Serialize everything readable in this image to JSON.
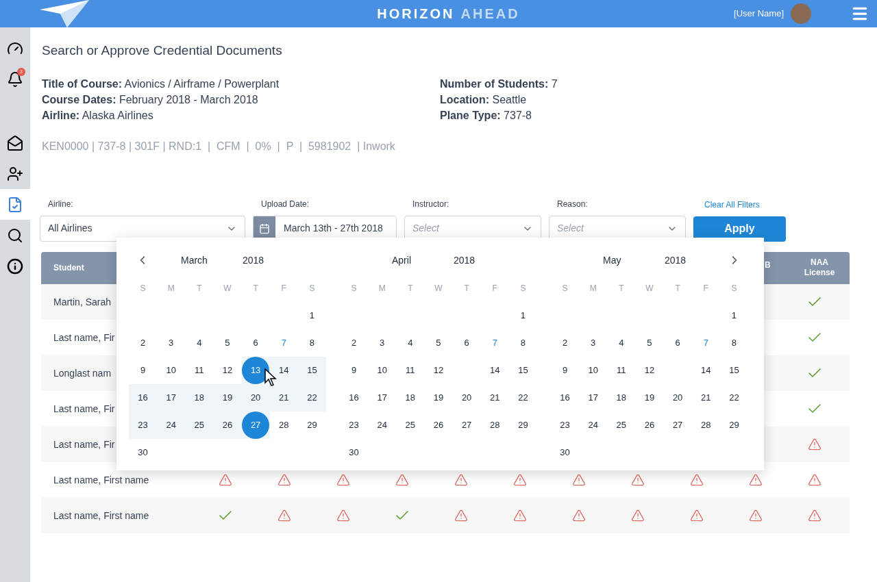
{
  "topbar": {
    "brand_primary": "HORIZON",
    "brand_secondary": "AHEAD",
    "user_name": "[User Name]"
  },
  "sidebar": {
    "items": [
      {
        "kind": "gauge",
        "selected": false
      },
      {
        "kind": "bell",
        "selected": false,
        "badge": "3"
      },
      {
        "kind": "mail",
        "selected": false
      },
      {
        "kind": "user-add",
        "selected": false
      },
      {
        "kind": "document",
        "selected": true
      },
      {
        "kind": "search",
        "selected": false
      },
      {
        "kind": "info",
        "selected": false
      }
    ]
  },
  "page_title": "Search or Approve Credential Documents",
  "course_info": {
    "left": [
      {
        "label": "Title of Course:",
        "value": "Avionics / Airframe / Powerplant"
      },
      {
        "label": "Course Dates:",
        "value": "February 2018 - March 2018"
      },
      {
        "label": "Airline:",
        "value": "Alaska Airlines"
      }
    ],
    "right": [
      {
        "label": "Number of Students:",
        "value": "7"
      },
      {
        "label": "Location:",
        "value": "Seattle"
      },
      {
        "label": "Plane Type:",
        "value": "737-8"
      }
    ],
    "code_line": "KEN0000 | 737-8 | 301F | RND:1  |  CFM  |  0%  |  P  |  5981902  | Inwork"
  },
  "filters": {
    "airline": {
      "label": "Airline:",
      "value": "All Airlines"
    },
    "upload_date": {
      "label": "Upload Date:",
      "value": "March 13th -  27th 2018"
    },
    "instructor": {
      "label": "Instructor:",
      "placeholder": "Select"
    },
    "reason": {
      "label": "Reason:",
      "placeholder": "Select"
    },
    "clear_link": "Clear All Filters",
    "apply_button": "Apply"
  },
  "table": {
    "columns": [
      "Student",
      "B",
      "NAA License"
    ],
    "rows": [
      {
        "student": "Martin, Sarah",
        "naa_license": {
          "kind": "check"
        }
      },
      {
        "student": "Last name, Fir",
        "naa_license": {
          "kind": "check"
        }
      },
      {
        "student": "Longlast nam",
        "naa_license": {
          "kind": "check"
        }
      },
      {
        "student": "Last name, Fir",
        "naa_license": {
          "kind": "check"
        }
      },
      {
        "student": "Last name, Fir",
        "naa_license": {
          "kind": "warning"
        }
      },
      {
        "student": "Last name, First name",
        "cells": [
          {
            "kind": "warning"
          },
          {
            "kind": "warning"
          },
          {
            "kind": "warning"
          },
          {
            "kind": "warning"
          },
          {
            "kind": "warning"
          },
          {
            "kind": "warning"
          },
          {
            "kind": "warning"
          },
          {
            "kind": "warning"
          },
          {
            "kind": "warning"
          },
          {
            "kind": "warning"
          }
        ],
        "naa_license": {
          "kind": "warning"
        }
      },
      {
        "student": "Last name, First name",
        "cells": [
          {
            "kind": "check"
          },
          {
            "kind": "warning"
          },
          {
            "kind": "warning"
          },
          {
            "kind": "check"
          },
          {
            "kind": "warning"
          },
          {
            "kind": "warning"
          },
          {
            "kind": "warning"
          },
          {
            "kind": "warning"
          },
          {
            "kind": "warning"
          },
          {
            "kind": "warning"
          }
        ],
        "naa_license": {
          "kind": "warning"
        }
      }
    ]
  },
  "calendar": {
    "months": [
      {
        "month": "March",
        "year": "2018",
        "weekdays": [
          "S",
          "M",
          "T",
          "W",
          "T",
          "F",
          "S"
        ],
        "weeks": [
          {
            "days": [
              {
                "kind": "day",
                "label": "1",
                "selected": false,
                "in_range": false,
                "accent": false
              }
            ]
          },
          {
            "days": [
              {
                "kind": "day",
                "label": "2",
                "selected": false,
                "in_range": false,
                "accent": false
              },
              {
                "kind": "day",
                "label": "3",
                "selected": false,
                "in_range": false,
                "accent": false
              },
              {
                "kind": "day",
                "label": "4",
                "selected": false,
                "in_range": false,
                "accent": false
              },
              {
                "kind": "day",
                "label": "5",
                "selected": false,
                "in_range": false,
                "accent": false
              },
              {
                "kind": "day",
                "label": "6",
                "selected": false,
                "in_range": false,
                "accent": false
              },
              {
                "kind": "day",
                "label": "7",
                "selected": false,
                "in_range": false,
                "accent": true
              },
              {
                "kind": "day",
                "label": "8",
                "selected": false,
                "in_range": false,
                "accent": false
              }
            ]
          },
          {
            "days": [
              {
                "kind": "day",
                "label": "9",
                "selected": false,
                "in_range": false,
                "accent": false
              },
              {
                "kind": "day",
                "label": "10",
                "selected": false,
                "in_range": false,
                "accent": false
              },
              {
                "kind": "day",
                "label": "11",
                "selected": false,
                "in_range": false,
                "accent": false
              },
              {
                "kind": "day",
                "label": "12",
                "selected": false,
                "in_range": false,
                "accent": false
              },
              {
                "kind": "day",
                "label": "13",
                "selected": true,
                "in_range": true,
                "accent": false
              },
              {
                "kind": "day",
                "label": "14",
                "selected": false,
                "in_range": true,
                "accent": false
              },
              {
                "kind": "day",
                "label": "15",
                "selected": false,
                "in_range": true,
                "accent": false
              }
            ]
          },
          {
            "days": [
              {
                "kind": "day",
                "label": "16",
                "selected": false,
                "in_range": true,
                "accent": false
              },
              {
                "kind": "day",
                "label": "17",
                "selected": false,
                "in_range": true,
                "accent": false
              },
              {
                "kind": "day",
                "label": "18",
                "selected": false,
                "in_range": true,
                "accent": false
              },
              {
                "kind": "day",
                "label": "19",
                "selected": false,
                "in_range": true,
                "accent": false
              },
              {
                "kind": "day",
                "label": "20",
                "selected": false,
                "in_range": true,
                "accent": false
              },
              {
                "kind": "day",
                "label": "21",
                "selected": false,
                "in_range": true,
                "accent": false
              },
              {
                "kind": "day",
                "label": "22",
                "selected": false,
                "in_range": true,
                "accent": false
              }
            ]
          },
          {
            "days": [
              {
                "kind": "day",
                "label": "23",
                "selected": false,
                "in_range": true,
                "accent": false
              },
              {
                "kind": "day",
                "label": "24",
                "selected": false,
                "in_range": true,
                "accent": false
              },
              {
                "kind": "day",
                "label": "25",
                "selected": false,
                "in_range": true,
                "accent": false
              },
              {
                "kind": "day",
                "label": "26",
                "selected": false,
                "in_range": true,
                "accent": false
              },
              {
                "kind": "day",
                "label": "27",
                "selected": true,
                "in_range": true,
                "accent": false
              },
              {
                "kind": "day",
                "label": "28",
                "selected": false,
                "in_range": false,
                "accent": false
              },
              {
                "kind": "day",
                "label": "29",
                "selected": false,
                "in_range": false,
                "accent": false
              }
            ]
          },
          {
            "days": [
              {
                "kind": "day",
                "label": "30",
                "selected": false,
                "in_range": false,
                "accent": false
              }
            ]
          }
        ]
      },
      {
        "month": "April",
        "year": "2018",
        "weekdays": [
          "S",
          "M",
          "T",
          "W",
          "T",
          "F",
          "S"
        ],
        "weeks": [
          {
            "days": [
              {
                "kind": "day",
                "label": "1",
                "selected": false,
                "in_range": false,
                "accent": false
              }
            ]
          },
          {
            "days": [
              {
                "kind": "day",
                "label": "2",
                "selected": false,
                "in_range": false,
                "accent": false
              },
              {
                "kind": "day",
                "label": "3",
                "selected": false,
                "in_range": false,
                "accent": false
              },
              {
                "kind": "day",
                "label": "4",
                "selected": false,
                "in_range": false,
                "accent": false
              },
              {
                "kind": "day",
                "label": "5",
                "selected": false,
                "in_range": false,
                "accent": false
              },
              {
                "kind": "day",
                "label": "6",
                "selected": false,
                "in_range": false,
                "accent": false
              },
              {
                "kind": "day",
                "label": "7",
                "selected": false,
                "in_range": false,
                "accent": true
              },
              {
                "kind": "day",
                "label": "8",
                "selected": false,
                "in_range": false,
                "accent": false
              }
            ]
          },
          {
            "days": [
              {
                "kind": "day",
                "label": "9",
                "selected": false,
                "in_range": false,
                "accent": false
              },
              {
                "kind": "day",
                "label": "10",
                "selected": false,
                "in_range": false,
                "accent": false
              },
              {
                "kind": "day",
                "label": "11",
                "selected": false,
                "in_range": false,
                "accent": false
              },
              {
                "kind": "day",
                "label": "12",
                "selected": false,
                "in_range": false,
                "accent": false
              },
              {
                "kind": "empty"
              },
              {
                "kind": "day",
                "label": "14",
                "selected": false,
                "in_range": false,
                "accent": false
              },
              {
                "kind": "day",
                "label": "15",
                "selected": false,
                "in_range": false,
                "accent": false
              }
            ]
          },
          {
            "days": [
              {
                "kind": "day",
                "label": "16",
                "selected": false,
                "in_range": false,
                "accent": false
              },
              {
                "kind": "day",
                "label": "17",
                "selected": false,
                "in_range": false,
                "accent": false
              },
              {
                "kind": "day",
                "label": "18",
                "selected": false,
                "in_range": false,
                "accent": false
              },
              {
                "kind": "day",
                "label": "19",
                "selected": false,
                "in_range": false,
                "accent": false
              },
              {
                "kind": "day",
                "label": "20",
                "selected": false,
                "in_range": false,
                "accent": false
              },
              {
                "kind": "day",
                "label": "21",
                "selected": false,
                "in_range": false,
                "accent": false
              },
              {
                "kind": "day",
                "label": "22",
                "selected": false,
                "in_range": false,
                "accent": false
              }
            ]
          },
          {
            "days": [
              {
                "kind": "day",
                "label": "23",
                "selected": false,
                "in_range": false,
                "accent": false
              },
              {
                "kind": "day",
                "label": "24",
                "selected": false,
                "in_range": false,
                "accent": false
              },
              {
                "kind": "day",
                "label": "25",
                "selected": false,
                "in_range": false,
                "accent": false
              },
              {
                "kind": "day",
                "label": "26",
                "selected": false,
                "in_range": false,
                "accent": false
              },
              {
                "kind": "day",
                "label": "27",
                "selected": false,
                "in_range": false,
                "accent": false
              },
              {
                "kind": "day",
                "label": "28",
                "selected": false,
                "in_range": false,
                "accent": false
              },
              {
                "kind": "day",
                "label": "29",
                "selected": false,
                "in_range": false,
                "accent": false
              }
            ]
          },
          {
            "days": [
              {
                "kind": "day",
                "label": "30",
                "selected": false,
                "in_range": false,
                "accent": false
              }
            ]
          }
        ]
      },
      {
        "month": "May",
        "year": "2018",
        "weekdays": [
          "S",
          "M",
          "T",
          "W",
          "T",
          "F",
          "S"
        ],
        "weeks": [
          {
            "days": [
              {
                "kind": "day",
                "label": "1",
                "selected": false,
                "in_range": false,
                "accent": false
              }
            ]
          },
          {
            "days": [
              {
                "kind": "day",
                "label": "2",
                "selected": false,
                "in_range": false,
                "accent": false
              },
              {
                "kind": "day",
                "label": "3",
                "selected": false,
                "in_range": false,
                "accent": false
              },
              {
                "kind": "day",
                "label": "4",
                "selected": false,
                "in_range": false,
                "accent": false
              },
              {
                "kind": "day",
                "label": "5",
                "selected": false,
                "in_range": false,
                "accent": false
              },
              {
                "kind": "day",
                "label": "6",
                "selected": false,
                "in_range": false,
                "accent": false
              },
              {
                "kind": "day",
                "label": "7",
                "selected": false,
                "in_range": false,
                "accent": true
              },
              {
                "kind": "day",
                "label": "8",
                "selected": false,
                "in_range": false,
                "accent": false
              }
            ]
          },
          {
            "days": [
              {
                "kind": "day",
                "label": "9",
                "selected": false,
                "in_range": false,
                "accent": false
              },
              {
                "kind": "day",
                "label": "10",
                "selected": false,
                "in_range": false,
                "accent": false
              },
              {
                "kind": "day",
                "label": "11",
                "selected": false,
                "in_range": false,
                "accent": false
              },
              {
                "kind": "day",
                "label": "12",
                "selected": false,
                "in_range": false,
                "accent": false
              },
              {
                "kind": "empty"
              },
              {
                "kind": "day",
                "label": "14",
                "selected": false,
                "in_range": false,
                "accent": false
              },
              {
                "kind": "day",
                "label": "15",
                "selected": false,
                "in_range": false,
                "accent": false
              }
            ]
          },
          {
            "days": [
              {
                "kind": "day",
                "label": "16",
                "selected": false,
                "in_range": false,
                "accent": false
              },
              {
                "kind": "day",
                "label": "17",
                "selected": false,
                "in_range": false,
                "accent": false
              },
              {
                "kind": "day",
                "label": "18",
                "selected": false,
                "in_range": false,
                "accent": false
              },
              {
                "kind": "day",
                "label": "19",
                "selected": false,
                "in_range": false,
                "accent": false
              },
              {
                "kind": "day",
                "label": "20",
                "selected": false,
                "in_range": false,
                "accent": false
              },
              {
                "kind": "day",
                "label": "21",
                "selected": false,
                "in_range": false,
                "accent": false
              },
              {
                "kind": "day",
                "label": "22",
                "selected": false,
                "in_range": false,
                "accent": false
              }
            ]
          },
          {
            "days": [
              {
                "kind": "day",
                "label": "23",
                "selected": false,
                "in_range": false,
                "accent": false
              },
              {
                "kind": "day",
                "label": "24",
                "selected": false,
                "in_range": false,
                "accent": false
              },
              {
                "kind": "day",
                "label": "25",
                "selected": false,
                "in_range": false,
                "accent": false
              },
              {
                "kind": "day",
                "label": "26",
                "selected": false,
                "in_range": false,
                "accent": false
              },
              {
                "kind": "day",
                "label": "27",
                "selected": false,
                "in_range": false,
                "accent": false
              },
              {
                "kind": "day",
                "label": "28",
                "selected": false,
                "in_range": false,
                "accent": false
              },
              {
                "kind": "day",
                "label": "29",
                "selected": false,
                "in_range": false,
                "accent": false
              }
            ]
          },
          {
            "days": [
              {
                "kind": "day",
                "label": "30",
                "selected": false,
                "in_range": false,
                "accent": false
              }
            ]
          }
        ]
      }
    ]
  }
}
